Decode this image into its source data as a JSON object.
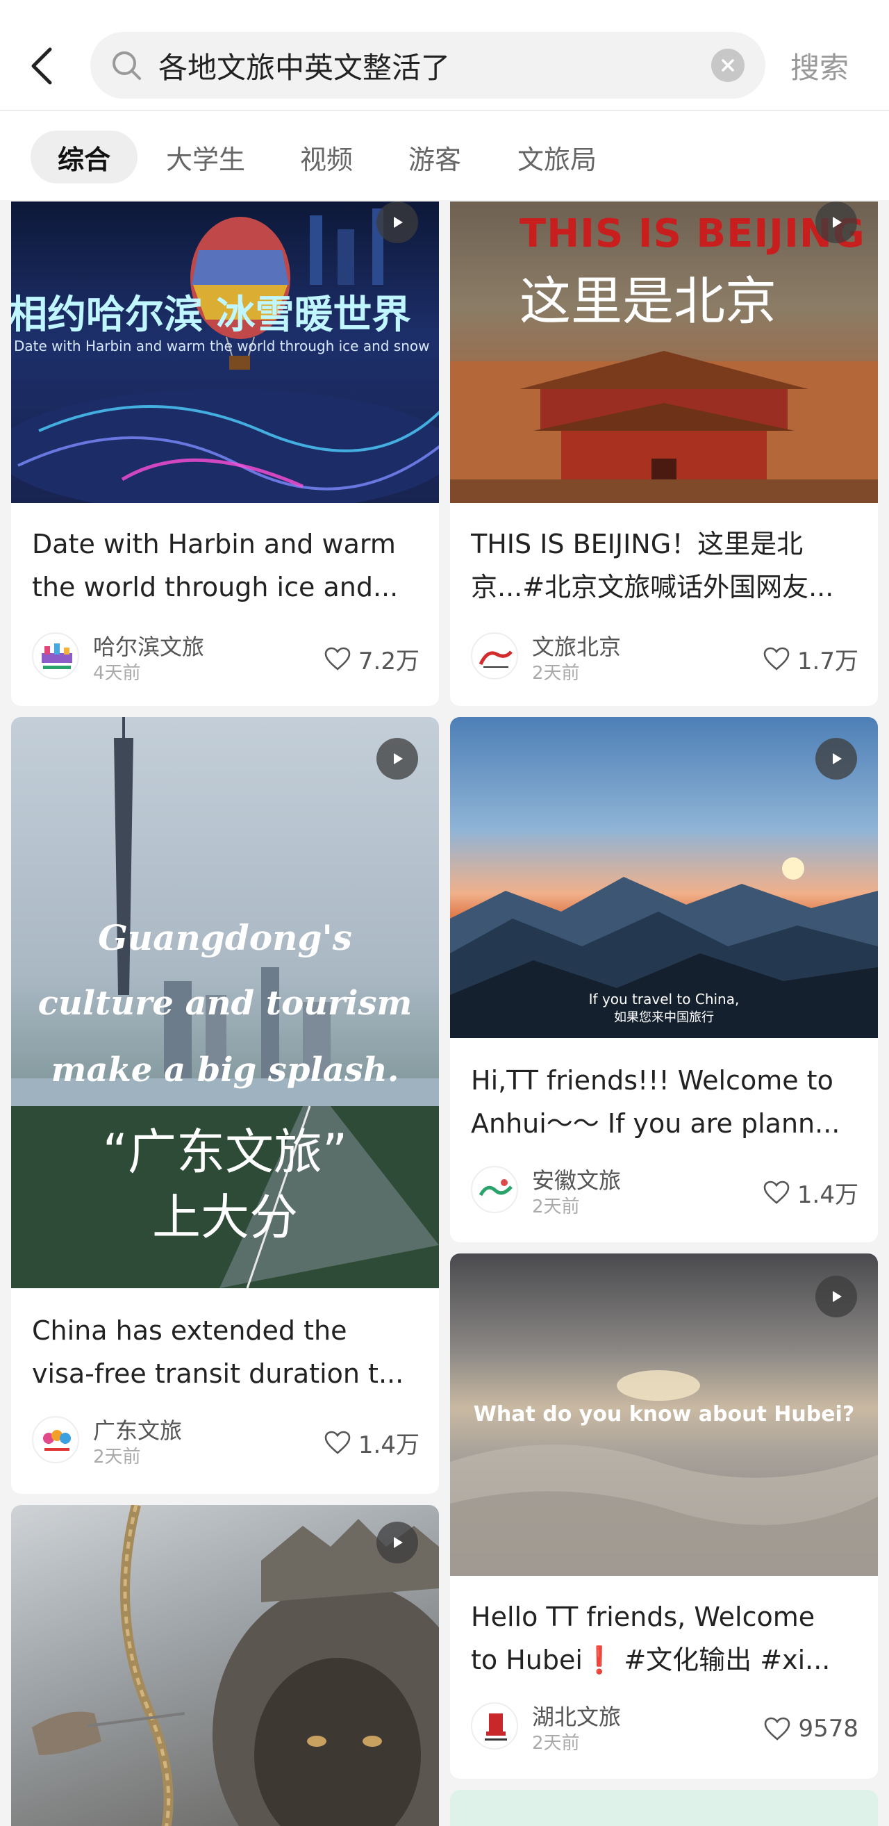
{
  "header": {
    "query": "各地文旅中英文整活了",
    "search_label": "搜索"
  },
  "tabs": [
    "综合",
    "大学生",
    "视频",
    "游客",
    "文旅局"
  ],
  "cards": [
    {
      "id": "harbin",
      "overlay": [
        "相约哈尔滨 冰雪暖世界",
        "Date with Harbin and warm the world through ice and snow"
      ],
      "title_lines": [
        "Date with Harbin and warm",
        "the world through ice and..."
      ],
      "author": "哈尔滨文旅",
      "time": "4天前",
      "likes": "7.2万"
    },
    {
      "id": "beijing",
      "overlay": [
        "THIS IS BEIJING",
        "这里是北京"
      ],
      "title_lines": [
        "THIS IS BEIJING！这里是北",
        "京...#北京文旅喊话外国网友..."
      ],
      "author": "文旅北京",
      "time": "2天前",
      "likes": "1.7万"
    },
    {
      "id": "guangdong",
      "overlay": [
        "Guangdong's",
        "culture and tourism",
        "make a big splash.",
        "“广东文旅”",
        "上大分"
      ],
      "title_lines": [
        "China has extended the",
        "visa-free transit duration t..."
      ],
      "author": "广东文旅",
      "time": "2天前",
      "likes": "1.4万"
    },
    {
      "id": "anhui",
      "overlay": [
        "If you travel to China,",
        "如果您来中国旅行"
      ],
      "title_lines": [
        "Hi,TT friends!!! Welcome to",
        "Anhui～～ If you are plann..."
      ],
      "author": "安徽文旅",
      "time": "2天前",
      "likes": "1.4万"
    },
    {
      "id": "hubei",
      "overlay": [
        "What do you know about Hubei?"
      ],
      "title_lines": [
        "Hello TT friends, Welcome",
        "to Hubei❗ #文化输出 #xi..."
      ],
      "author": "湖北文旅",
      "time": "2天前",
      "likes": "9578"
    },
    {
      "id": "wukong",
      "overlay": []
    }
  ]
}
